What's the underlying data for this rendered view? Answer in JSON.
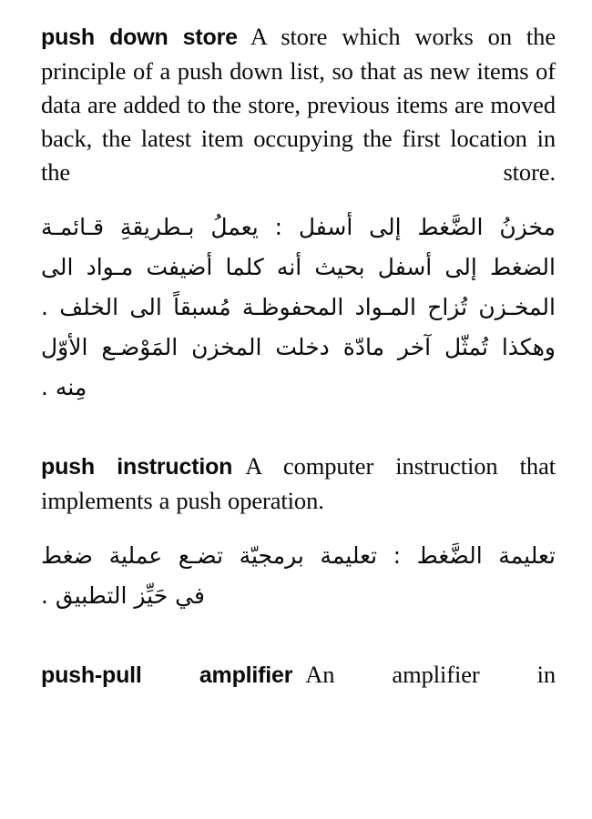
{
  "page": {
    "kind": "scanned-dictionary-page",
    "background_color": "#ffffff",
    "text_color": "#0b0b0b",
    "language_pair": "English-Arabic"
  },
  "entries": [
    {
      "id": "push-down-store",
      "headword": "push down store",
      "definition_lines": [
        "A store which works",
        "on the principle of a push down list, so that",
        "as new items of data are added to the store,",
        "previous items are moved back, the latest",
        "item occupying the first location in the",
        "store."
      ],
      "definition_full": "A store which works on the principle of a push down list, so that as new items of data are added to the store, previous items are moved back, the latest item occupying the first location in the store.",
      "arabic_lines": [
        "مخزنُ الضَّغط إلى أسفل : يعملُ بـطريقةِ قـائمـة",
        "الضغط إلى أسفل بحيث أنه كلما أضيفت مـواد الى",
        "المخـزن تُزاح المـواد المحفوظـة مُسبقاً الى الخلف .",
        "وهكذا تُمثّل آخر مادّة دخلت المخزن المَوْضـع الأوّل",
        "مِنه ."
      ],
      "arabic_full": "مخزنُ الضَّغط إلى أسفل : يعملُ بطريقةِ قائمة الضغط إلى أسفل بحيث أنه كلما أضيفت مواد الى المخزن تُزاح المواد المحفوظة مُسبقاً الى الخلف . وهكذا تُمثّل آخر مادّة دخلت المخزن المَوْضع الأوّل مِنه ."
    },
    {
      "id": "push-instruction",
      "headword": "push instruction",
      "definition_lines": [
        "A computer instruc-",
        "tion that implements a push operation."
      ],
      "definition_full": "A computer instruction that implements a push operation.",
      "arabic_lines": [
        "تعليمة الضَّغط : تعليمة برمجيّة تضـع عملية ضغط",
        "في حَيِّز التطبيق ."
      ],
      "arabic_full": "تعليمة الضَّغط : تعليمة برمجيّة تضع عملية ضغط في حَيِّز التطبيق ."
    },
    {
      "id": "push-pull-amplifier",
      "headword": "push-pull  amplifier",
      "definition_lines": [
        "An  amplifier  in"
      ],
      "definition_full": "An amplifier in",
      "arabic_lines": [],
      "arabic_full": ""
    }
  ]
}
